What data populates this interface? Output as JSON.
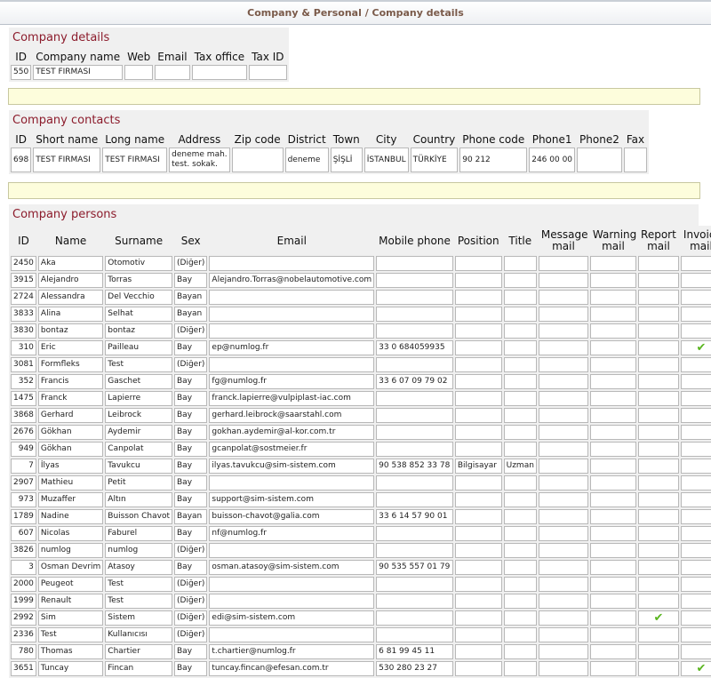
{
  "breadcrumb": "Company & Personal / Company details",
  "company_details": {
    "title": "Company details",
    "headers": [
      "ID",
      "Company name",
      "Web",
      "Email",
      "Tax office",
      "Tax ID"
    ],
    "row": {
      "id": "550",
      "company_name": "TEST FIRMASI",
      "web": "",
      "email": "",
      "tax_office": "",
      "tax_id": ""
    }
  },
  "company_contacts": {
    "title": "Company contacts",
    "headers": [
      "ID",
      "Short name",
      "Long name",
      "Address",
      "Zip code",
      "District",
      "Town",
      "City",
      "Country",
      "Phone code",
      "Phone1",
      "Phone2",
      "Fax"
    ],
    "row": {
      "id": "698",
      "short_name": "TEST FIRMASI",
      "long_name": "TEST FIRMASI",
      "address_line1": "deneme mah.",
      "address_line2": "test. sokak.",
      "zip": "",
      "district": "deneme",
      "town": "ŞİŞLİ",
      "city": "İSTANBUL",
      "country": "TÜRKİYE",
      "phone_code": "90 212",
      "phone1": "246 00 00",
      "phone2": "",
      "fax": ""
    }
  },
  "company_persons": {
    "title": "Company persons",
    "headers": [
      "ID",
      "Name",
      "Surname",
      "Sex",
      "Email",
      "Mobile phone",
      "Position",
      "Title",
      "Message mail",
      "Warning mail",
      "Report mail",
      "Invoice mail"
    ],
    "rows": [
      {
        "id": "2450",
        "name": "Aka",
        "surname": "Otomotiv",
        "sex": "(Diğer)",
        "email": "",
        "mobile": "",
        "position": "",
        "title": "",
        "report": false,
        "invoice": false
      },
      {
        "id": "3915",
        "name": "Alejandro",
        "surname": "Torras",
        "sex": "Bay",
        "email": "Alejandro.Torras@nobelautomotive.com",
        "mobile": "",
        "position": "",
        "title": "",
        "report": false,
        "invoice": false
      },
      {
        "id": "2724",
        "name": "Alessandra",
        "surname": "Del Vecchio",
        "sex": "Bayan",
        "email": "",
        "mobile": "",
        "position": "",
        "title": "",
        "report": false,
        "invoice": false
      },
      {
        "id": "3833",
        "name": "Alina",
        "surname": "Selhat",
        "sex": "Bayan",
        "email": "",
        "mobile": "",
        "position": "",
        "title": "",
        "report": false,
        "invoice": false
      },
      {
        "id": "3830",
        "name": "bontaz",
        "surname": "bontaz",
        "sex": "(Diğer)",
        "email": "",
        "mobile": "",
        "position": "",
        "title": "",
        "report": false,
        "invoice": false
      },
      {
        "id": "310",
        "name": "Eric",
        "surname": "Pailleau",
        "sex": "Bay",
        "email": "ep@numlog.fr",
        "mobile": "33  0  684059935",
        "position": "",
        "title": "",
        "report": false,
        "invoice": true
      },
      {
        "id": "3081",
        "name": "Formfleks",
        "surname": "Test",
        "sex": "(Diğer)",
        "email": "",
        "mobile": "",
        "position": "",
        "title": "",
        "report": false,
        "invoice": false
      },
      {
        "id": "352",
        "name": "Francis",
        "surname": "Gaschet",
        "sex": "Bay",
        "email": "fg@numlog.fr",
        "mobile": "33  6  07 09 79 02",
        "position": "",
        "title": "",
        "report": false,
        "invoice": false
      },
      {
        "id": "1475",
        "name": "Franck",
        "surname": "Lapierre",
        "sex": "Bay",
        "email": "franck.lapierre@vulpiplast-iac.com",
        "mobile": "",
        "position": "",
        "title": "",
        "report": false,
        "invoice": false
      },
      {
        "id": "3868",
        "name": "Gerhard",
        "surname": "Leibrock",
        "sex": "Bay",
        "email": "gerhard.leibrock@saarstahl.com",
        "mobile": "",
        "position": "",
        "title": "",
        "report": false,
        "invoice": false
      },
      {
        "id": "2676",
        "name": "Gökhan",
        "surname": "Aydemir",
        "sex": "Bay",
        "email": "gokhan.aydemir@al-kor.com.tr",
        "mobile": "",
        "position": "",
        "title": "",
        "report": false,
        "invoice": false
      },
      {
        "id": "949",
        "name": "Gökhan",
        "surname": "Canpolat",
        "sex": "Bay",
        "email": "gcanpolat@sostmeier.fr",
        "mobile": "",
        "position": "",
        "title": "",
        "report": false,
        "invoice": false
      },
      {
        "id": "7",
        "name": "İlyas",
        "surname": "Tavukcu",
        "sex": "Bay",
        "email": "ilyas.tavukcu@sim-sistem.com",
        "mobile": "90  538  852 33 78",
        "position": "Bilgisayar",
        "title": "Uzman",
        "report": false,
        "invoice": false
      },
      {
        "id": "2907",
        "name": "Mathieu",
        "surname": "Petit",
        "sex": "Bay",
        "email": "",
        "mobile": "",
        "position": "",
        "title": "",
        "report": false,
        "invoice": false
      },
      {
        "id": "973",
        "name": "Muzaffer",
        "surname": "Altın",
        "sex": "Bay",
        "email": "support@sim-sistem.com",
        "mobile": "",
        "position": "",
        "title": "",
        "report": false,
        "invoice": false
      },
      {
        "id": "1789",
        "name": "Nadine",
        "surname": "Buisson Chavot",
        "sex": "Bayan",
        "email": "buisson-chavot@galia.com",
        "mobile": "33  6  14 57 90 01",
        "position": "",
        "title": "",
        "report": false,
        "invoice": false
      },
      {
        "id": "607",
        "name": "Nicolas",
        "surname": "Faburel",
        "sex": "Bay",
        "email": "nf@numlog.fr",
        "mobile": "",
        "position": "",
        "title": "",
        "report": false,
        "invoice": false
      },
      {
        "id": "3826",
        "name": "numlog",
        "surname": "numlog",
        "sex": "(Diğer)",
        "email": "",
        "mobile": "",
        "position": "",
        "title": "",
        "report": false,
        "invoice": false
      },
      {
        "id": "3",
        "name": "Osman Devrim",
        "surname": "Atasoy",
        "sex": "Bay",
        "email": "osman.atasoy@sim-sistem.com",
        "mobile": "90  535  557 01 79",
        "position": "",
        "title": "",
        "report": false,
        "invoice": false
      },
      {
        "id": "2000",
        "name": "Peugeot",
        "surname": "Test",
        "sex": "(Diğer)",
        "email": "",
        "mobile": "",
        "position": "",
        "title": "",
        "report": false,
        "invoice": false
      },
      {
        "id": "1999",
        "name": "Renault",
        "surname": "Test",
        "sex": "(Diğer)",
        "email": "",
        "mobile": "",
        "position": "",
        "title": "",
        "report": false,
        "invoice": false
      },
      {
        "id": "2992",
        "name": "Sim",
        "surname": "Sistem",
        "sex": "(Diğer)",
        "email": "edi@sim-sistem.com",
        "mobile": "",
        "position": "",
        "title": "",
        "report": true,
        "invoice": false
      },
      {
        "id": "2336",
        "name": "Test",
        "surname": "Kullanıcısı",
        "sex": "(Diğer)",
        "email": "",
        "mobile": "",
        "position": "",
        "title": "",
        "report": false,
        "invoice": false
      },
      {
        "id": "780",
        "name": "Thomas",
        "surname": "Chartier",
        "sex": "Bay",
        "email": "t.chartier@numlog.fr",
        "mobile": "6  81 99 45 11",
        "position": "",
        "title": "",
        "report": false,
        "invoice": false
      },
      {
        "id": "3651",
        "name": "Tuncay",
        "surname": "Fincan",
        "sex": "Bay",
        "email": "tuncay.fincan@efesan.com.tr",
        "mobile": "530  280 23 27",
        "position": "",
        "title": "",
        "report": false,
        "invoice": true
      }
    ]
  },
  "icons": {
    "check": "check-icon"
  },
  "colors": {
    "section_title": "#8c1c2c",
    "check": "#59b51e",
    "notice_bg": "#fdfddc"
  }
}
